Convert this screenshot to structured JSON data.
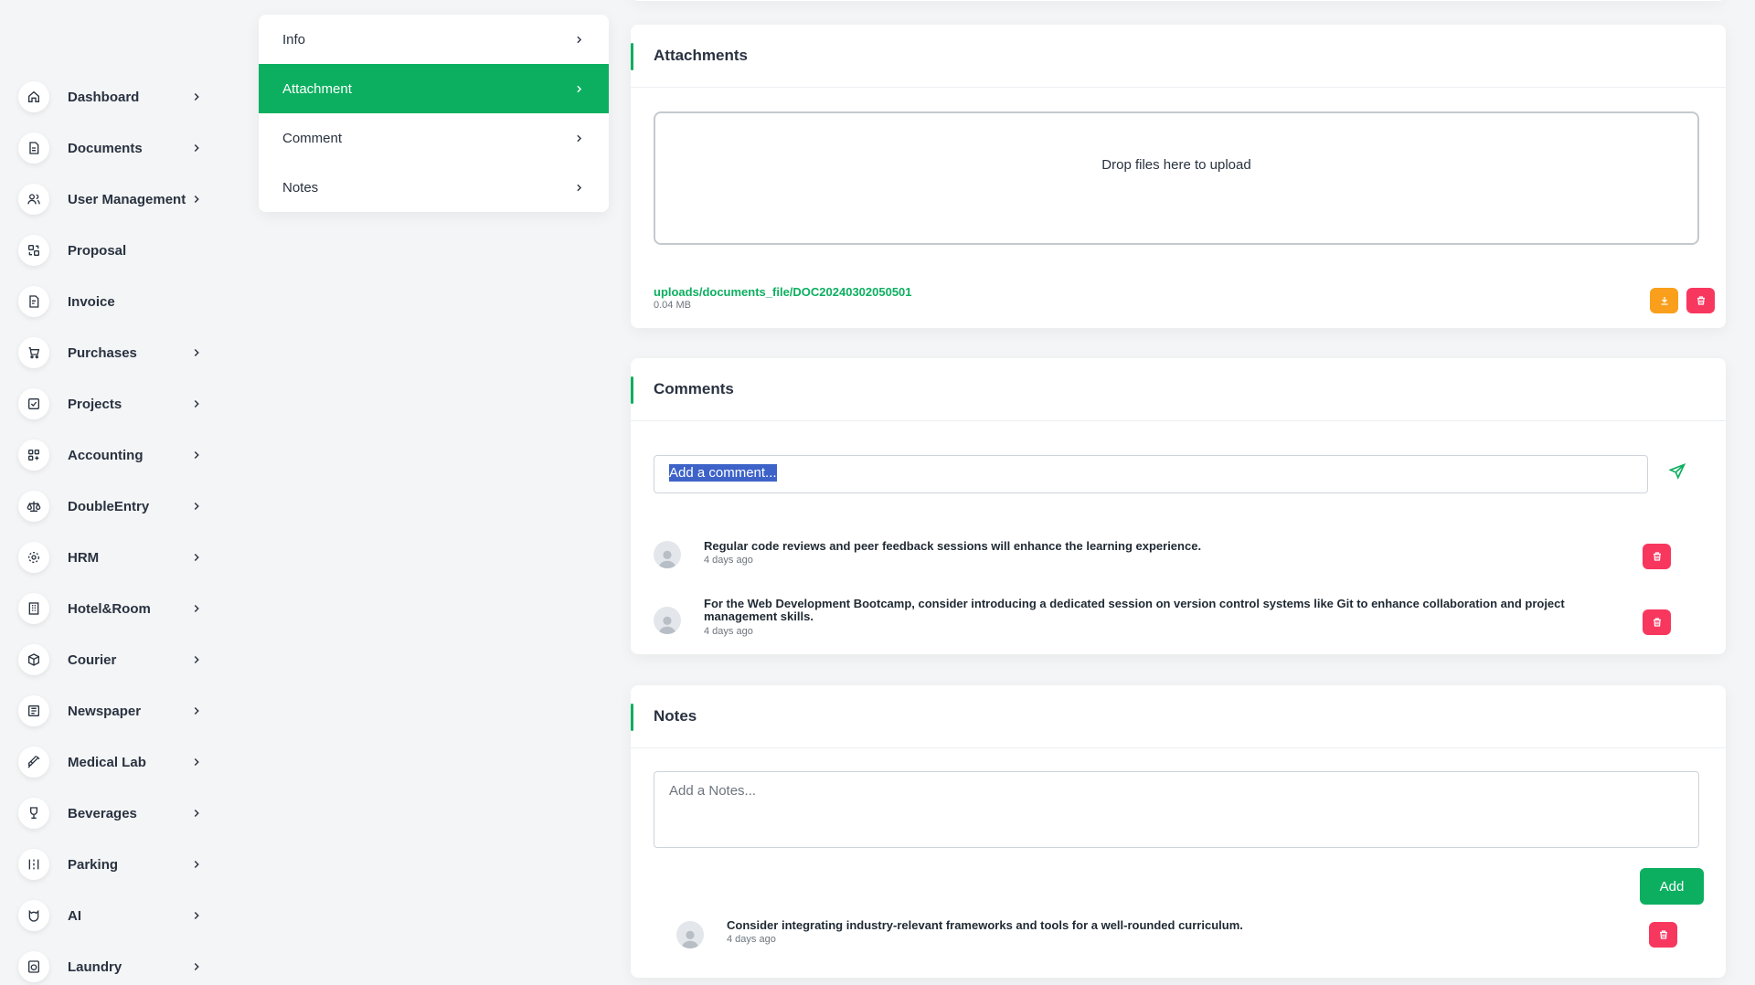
{
  "sidebar": {
    "items": [
      {
        "label": "Dashboard",
        "icon": "home-icon",
        "chevron": true
      },
      {
        "label": "Documents",
        "icon": "document-icon",
        "chevron": true
      },
      {
        "label": "User Management",
        "icon": "users-icon",
        "chevron": true
      },
      {
        "label": "Proposal",
        "icon": "proposal-icon",
        "chevron": false
      },
      {
        "label": "Invoice",
        "icon": "invoice-icon",
        "chevron": false
      },
      {
        "label": "Purchases",
        "icon": "cart-icon",
        "chevron": true
      },
      {
        "label": "Projects",
        "icon": "checkbox-icon",
        "chevron": true
      },
      {
        "label": "Accounting",
        "icon": "apps-icon",
        "chevron": true
      },
      {
        "label": "DoubleEntry",
        "icon": "scale-icon",
        "chevron": true
      },
      {
        "label": "HRM",
        "icon": "hrm-icon",
        "chevron": true
      },
      {
        "label": "Hotel&Room",
        "icon": "building-icon",
        "chevron": true
      },
      {
        "label": "Courier",
        "icon": "package-icon",
        "chevron": true
      },
      {
        "label": "Newspaper",
        "icon": "newspaper-icon",
        "chevron": true
      },
      {
        "label": "Medical Lab",
        "icon": "syringe-icon",
        "chevron": true
      },
      {
        "label": "Beverages",
        "icon": "glass-icon",
        "chevron": true
      },
      {
        "label": "Parking",
        "icon": "parking-icon",
        "chevron": true
      },
      {
        "label": "AI",
        "icon": "ai-icon",
        "chevron": true
      },
      {
        "label": "Laundry",
        "icon": "laundry-icon",
        "chevron": true
      }
    ]
  },
  "submenu": {
    "items": [
      {
        "label": "Info",
        "active": false
      },
      {
        "label": "Attachment",
        "active": true
      },
      {
        "label": "Comment",
        "active": false
      },
      {
        "label": "Notes",
        "active": false
      }
    ]
  },
  "attachments": {
    "title": "Attachments",
    "dropzone_text": "Drop files here to upload",
    "file": {
      "path": "uploads/documents_file/DOC20240302050501",
      "size": "0.04 MB"
    }
  },
  "comments": {
    "title": "Comments",
    "input_value": "Add a comment...",
    "items": [
      {
        "text": "Regular code reviews and peer feedback sessions will enhance the learning experience.",
        "time": "4 days ago"
      },
      {
        "text": "For the Web Development Bootcamp, consider introducing a dedicated session on version control systems like Git to enhance collaboration and project management skills.",
        "time": "4 days ago"
      }
    ]
  },
  "notes": {
    "title": "Notes",
    "placeholder": "Add a Notes...",
    "add_label": "Add",
    "items": [
      {
        "text": "Consider integrating industry-relevant frameworks and tools for a well-rounded curriculum.",
        "time": "4 days ago"
      }
    ]
  },
  "colors": {
    "accent": "#0caf60",
    "warning": "#fa9f1b",
    "danger": "#f8375f",
    "text": "#293240"
  }
}
